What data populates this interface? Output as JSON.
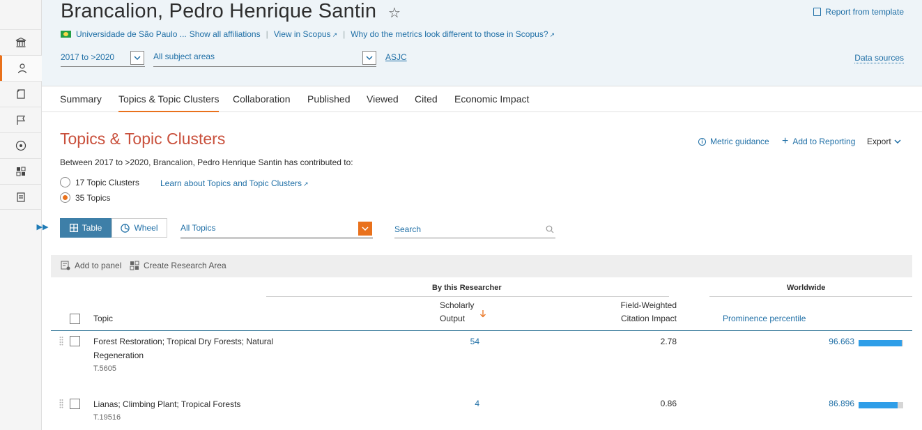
{
  "header": {
    "researcher_name": "Brancalion, Pedro Henrique Santin",
    "favorite_icon": "star-icon",
    "report_from_template": "Report from template",
    "affiliation": "Universidade de São Paulo ...",
    "show_all_affiliations": "Show all affiliations",
    "view_in_scopus": "View in Scopus",
    "metrics_question": "Why do the metrics look different to those in Scopus?",
    "year_range": "2017 to >2020",
    "subject_areas": "All subject areas",
    "asjc": "ASJC",
    "data_sources": "Data sources"
  },
  "tabs": [
    {
      "label": "Summary"
    },
    {
      "label": "Topics & Topic Clusters",
      "active": true
    },
    {
      "label": "Collaboration"
    },
    {
      "label": "Published"
    },
    {
      "label": "Viewed"
    },
    {
      "label": "Cited"
    },
    {
      "label": "Economic Impact"
    }
  ],
  "section": {
    "title": "Topics & Topic Clusters",
    "metric_guidance": "Metric guidance",
    "add_to_reporting": "Add to Reporting",
    "export": "Export",
    "description": "Between 2017 to >2020, Brancalion, Pedro Henrique Santin has contributed to:",
    "radio_clusters": "17 Topic Clusters",
    "radio_topics": "35 Topics",
    "selected_radio": "topics",
    "learn_link": "Learn about Topics and Topic Clusters"
  },
  "controls": {
    "view_table": "Table",
    "view_wheel": "Wheel",
    "topics_filter": "All Topics",
    "search_placeholder": "Search"
  },
  "toolbar": {
    "add_to_panel": "Add to panel",
    "create_research_area": "Create Research Area"
  },
  "table": {
    "group_researcher": "By this Researcher",
    "group_worldwide": "Worldwide",
    "col_topic": "Topic",
    "col_output_1": "Scholarly",
    "col_output_2": "Output",
    "col_fwci_1": "Field-Weighted",
    "col_fwci_2": "Citation Impact",
    "col_prominence": "Prominence percentile",
    "rows": [
      {
        "topic_line1": "Forest Restoration; Tropical Dry Forests; Natural",
        "topic_line2": "Regeneration",
        "code": "T.5605",
        "output": "54",
        "fwci": "2.78",
        "prominence": "96.663",
        "prominence_value": 96.663
      },
      {
        "topic_line1": "Lianas; Climbing Plant; Tropical Forests",
        "topic_line2": "",
        "code": "T.19516",
        "output": "4",
        "fwci": "0.86",
        "prominence": "86.896",
        "prominence_value": 86.896
      }
    ]
  },
  "colors": {
    "accent_orange": "#e9711c",
    "title_red": "#c9503c",
    "link_blue": "#1f6fa6",
    "bar_blue": "#2f9ee8"
  },
  "rail": {
    "icons": [
      "institution-icon",
      "researcher-icon",
      "publication-icon",
      "flag-icon",
      "target-icon",
      "dashboard-icon",
      "report-icon"
    ],
    "expand_icon": "expand-arrows-icon"
  }
}
